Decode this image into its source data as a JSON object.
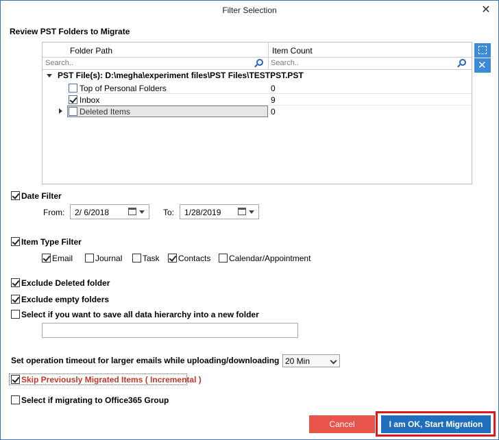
{
  "window": {
    "title": "Filter Selection",
    "close": "✕"
  },
  "review": {
    "heading": "Review PST Folders to Migrate",
    "columns": {
      "path": "Folder Path",
      "count": "Item Count"
    },
    "search_placeholder_path": "Search..",
    "search_placeholder_count": "Search..",
    "root": "PST File(s): D:\\megha\\experiment files\\PST Files\\TESTPST.PST",
    "rows": [
      {
        "label": "Top of Personal Folders",
        "count": "0",
        "checked": false
      },
      {
        "label": "Inbox",
        "count": "9",
        "checked": true
      },
      {
        "label": "Deleted Items",
        "count": "0",
        "checked": false
      }
    ]
  },
  "date_filter": {
    "label": "Date Filter",
    "checked": true,
    "from_label": "From:",
    "from": "2/  6/2018",
    "to_label": "To:",
    "to": "1/28/2019"
  },
  "item_type": {
    "label": "Item Type Filter",
    "checked": true,
    "options": [
      {
        "label": "Email",
        "checked": true
      },
      {
        "label": "Journal",
        "checked": false
      },
      {
        "label": "Task",
        "checked": false
      },
      {
        "label": "Contacts",
        "checked": true
      },
      {
        "label": "Calendar/Appointment",
        "checked": false
      }
    ]
  },
  "exclude_deleted": {
    "label": "Exclude Deleted folder",
    "checked": true
  },
  "exclude_empty": {
    "label": "Exclude empty folders",
    "checked": true
  },
  "save_hierarchy": {
    "label": "Select if you want to save all data hierarchy into a new folder",
    "checked": false,
    "value": ""
  },
  "timeout": {
    "label": "Set operation timeout for larger emails while uploading/downloading",
    "value": "20 Min"
  },
  "skip_migrated": {
    "label": "Skip Previously Migrated Items ( Incremental )",
    "checked": true,
    "color": "#c0392b"
  },
  "office365_group": {
    "label": "Select if migrating to Office365 Group",
    "checked": false
  },
  "buttons": {
    "cancel": "Cancel",
    "start": "I am OK, Start Migration"
  },
  "colors": {
    "accent": "#1f6fbd",
    "cancel": "#e8544a",
    "highlight": "#e3141c"
  }
}
